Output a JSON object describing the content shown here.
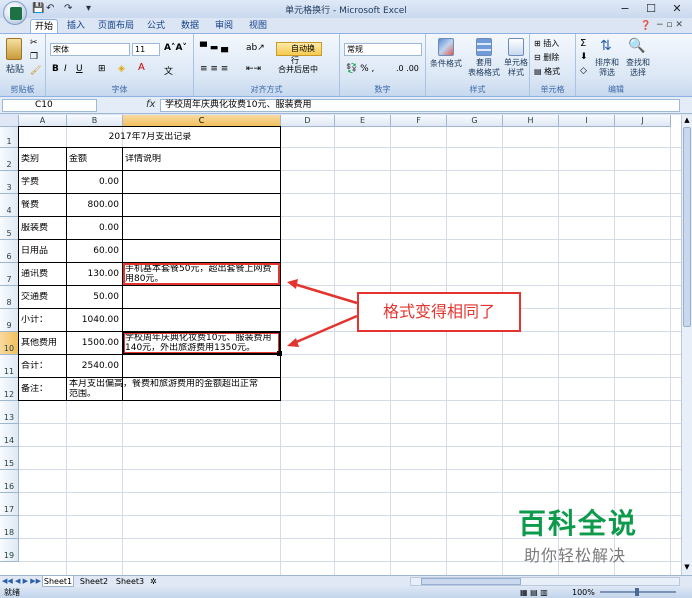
{
  "window": {
    "title": "单元格换行 - Microsoft Excel"
  },
  "ribbon_tabs": [
    "开始",
    "插入",
    "页面布局",
    "公式",
    "数据",
    "审阅",
    "视图"
  ],
  "ribbon": {
    "paste": "粘贴",
    "font_name": "宋体",
    "font_size": "11",
    "wrap_text": "自动换行",
    "merge_center": "合并后居中",
    "number_format": "常规",
    "conditional_format": "条件格式",
    "table_format": "套用\n表格格式",
    "cell_style": "单元格\n样式",
    "insert": "插入",
    "delete": "删除",
    "format": "格式",
    "sort_filter": "排序和\n筛选",
    "find_select": "查找和\n选择",
    "groups": [
      "剪贴板",
      "字体",
      "对齐方式",
      "数字",
      "样式",
      "单元格",
      "编辑"
    ]
  },
  "formula_bar": {
    "name_box": "C10",
    "fx": "fx",
    "content": "学校周年庆典化妆费10元、服装费用"
  },
  "columns": [
    "A",
    "B",
    "C",
    "D",
    "E",
    "F",
    "G",
    "H",
    "I",
    "J"
  ],
  "rows": [
    "1",
    "2",
    "3",
    "4",
    "5",
    "6",
    "7",
    "8",
    "9",
    "10",
    "11",
    "12",
    "13",
    "14",
    "15",
    "16",
    "17",
    "18",
    "19"
  ],
  "sheet": {
    "title": "2017年7月支出记录",
    "headers": {
      "a": "类别",
      "b": "金额",
      "c": "详情说明"
    },
    "data": [
      {
        "a": "学费",
        "b": "0.00",
        "c1": "",
        "c2": ""
      },
      {
        "a": "餐费",
        "b": "800.00",
        "c1": "",
        "c2": ""
      },
      {
        "a": "服装费",
        "b": "0.00",
        "c1": "",
        "c2": ""
      },
      {
        "a": "日用品",
        "b": "60.00",
        "c1": "",
        "c2": ""
      },
      {
        "a": "通讯费",
        "b": "130.00",
        "c1": "手机基本套餐50元，超出套餐上网费",
        "c2": "用80元。"
      },
      {
        "a": "交通费",
        "b": "50.00",
        "c1": "",
        "c2": ""
      },
      {
        "a": "小计：",
        "b": "1040.00",
        "c1": "",
        "c2": ""
      },
      {
        "a": "其他费用",
        "b": "1500.00",
        "c1": "学校周年庆典化妆费10元、服装费用",
        "c2": "140元，外出旅游费用1350元。"
      },
      {
        "a": "合计：",
        "b": "2540.00",
        "c1": "",
        "c2": ""
      }
    ],
    "note_label": "备注：",
    "note_line1": "本月支出偏高，餐费和旅游费用的金额超出正常",
    "note_line2": "范围。"
  },
  "annotation": {
    "text": "格式变得相同了",
    "color": "#e3342f"
  },
  "sheet_tabs": [
    "Sheet1",
    "Sheet2",
    "Sheet3"
  ],
  "status": {
    "ready": "就绪",
    "zoom": "100%"
  },
  "watermark": {
    "main": "百科全说",
    "sub": "助你轻松解决"
  }
}
